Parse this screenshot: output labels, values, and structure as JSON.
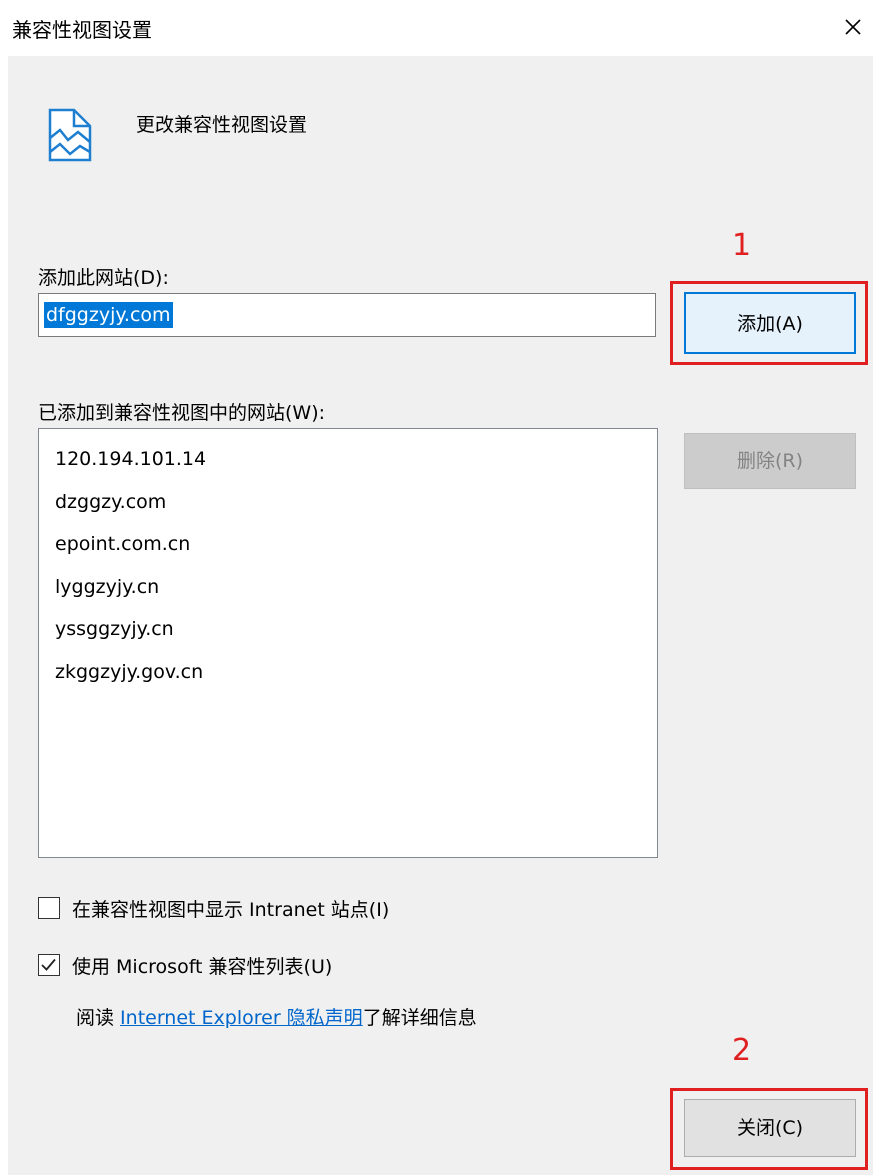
{
  "window": {
    "title": "兼容性视图设置"
  },
  "header": {
    "text": "更改兼容性视图设置",
    "icon": "compat-view-icon"
  },
  "add_site": {
    "label": "添加此网站(D):",
    "input_value": "dfggzyjy.com",
    "add_button": "添加(A)"
  },
  "site_list": {
    "label": "已添加到兼容性视图中的网站(W):",
    "items": [
      "120.194.101.14",
      "dzggzy.com",
      "epoint.com.cn",
      "lyggzyjy.cn",
      "yssggzyjy.cn",
      "zkggzyjy.gov.cn"
    ],
    "remove_button": "删除(R)"
  },
  "options": {
    "intranet": {
      "label": "在兼容性视图中显示 Intranet 站点(I)",
      "checked": false
    },
    "ms_list": {
      "label": "使用 Microsoft 兼容性列表(U)",
      "checked": true
    }
  },
  "privacy": {
    "prefix": "阅读 ",
    "link": "Internet Explorer 隐私声明",
    "suffix": "了解详细信息"
  },
  "footer": {
    "close_button": "关闭(C)"
  },
  "annotations": {
    "marker_1": "1",
    "marker_2": "2",
    "color": "#e02020"
  },
  "colors": {
    "accent": "#0078d7",
    "link": "#0066cc"
  }
}
